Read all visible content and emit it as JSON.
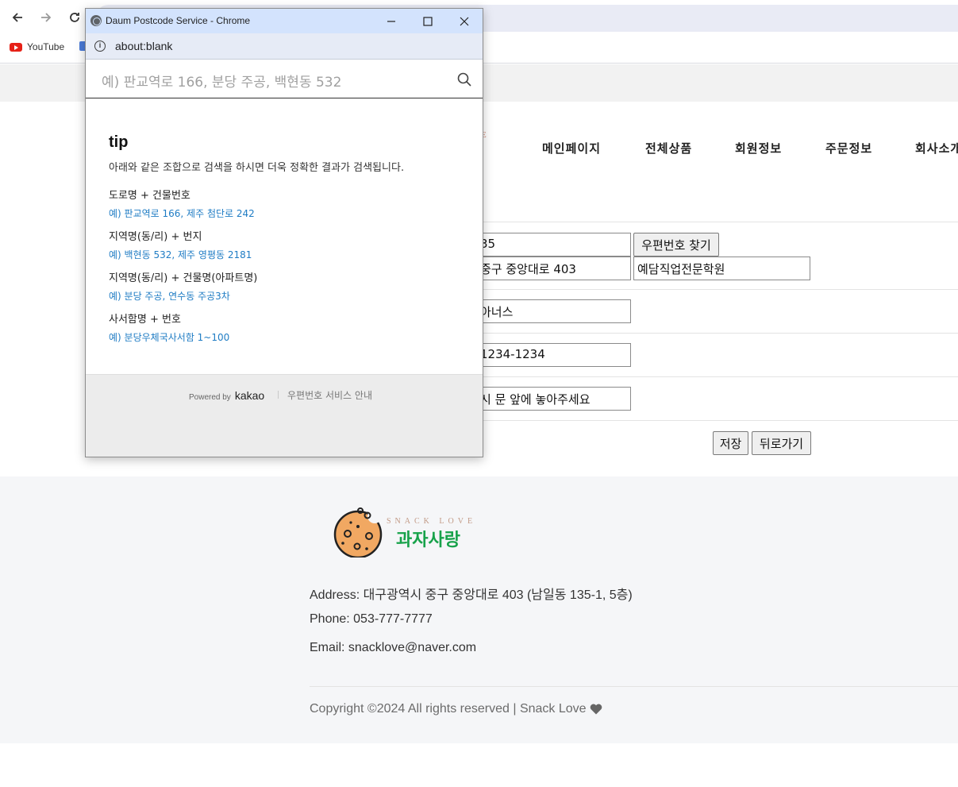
{
  "browser": {
    "bookmarks": [
      {
        "label": "YouTube"
      }
    ]
  },
  "page": {
    "logo_fragment": "E",
    "menu": [
      "메인페이지",
      "전체상품",
      "회원정보",
      "주문정보",
      "회사소개"
    ],
    "form": {
      "zipcode_value": "35",
      "find_zip_button": "우편번호 찾기",
      "address_value": "중구 중앙대로 403",
      "address_detail_value": "예담직업전문학원",
      "name_value": "아너스",
      "phone_value": "1234-1234",
      "request_value": "시 문 앞에 놓아주세요",
      "save_button": "저장",
      "back_button": "뒤로가기"
    }
  },
  "footer": {
    "brand_en": "SNACK LOVE",
    "brand_ko": "과자사랑",
    "address": "Address: 대구광역시 중구 중앙대로 403 (남일동 135-1, 5층)",
    "phone": "Phone: 053-777-7777",
    "email": "Email: snacklove@naver.com",
    "copyright": "Copyright ©2024 All rights reserved | Snack Love"
  },
  "popup": {
    "window_title": "Daum Postcode Service - Chrome",
    "address_bar": "about:blank",
    "search_placeholder": "예) 판교역로 166, 분당 주공, 백현동 532",
    "tip_title": "tip",
    "tip_description": "아래와 같은 조합으로 검색을 하시면 더욱 정확한 결과가 검색됩니다.",
    "tips": [
      {
        "heading": "도로명 + 건물번호",
        "example": "예) 판교역로 166,  제주 첨단로 242"
      },
      {
        "heading": "지역명(동/리) + 번지",
        "example": "예) 백현동 532,  제주 영평동 2181"
      },
      {
        "heading": "지역명(동/리) + 건물명(아파트명)",
        "example": "예) 분당 주공,  연수동 주공3차"
      },
      {
        "heading": "사서함명 + 번호",
        "example": "예) 분당우체국사서함 1~100"
      }
    ],
    "powered_by": "Powered by",
    "kakao": "kakao",
    "service_guide": "우편번호 서비스 안내"
  }
}
